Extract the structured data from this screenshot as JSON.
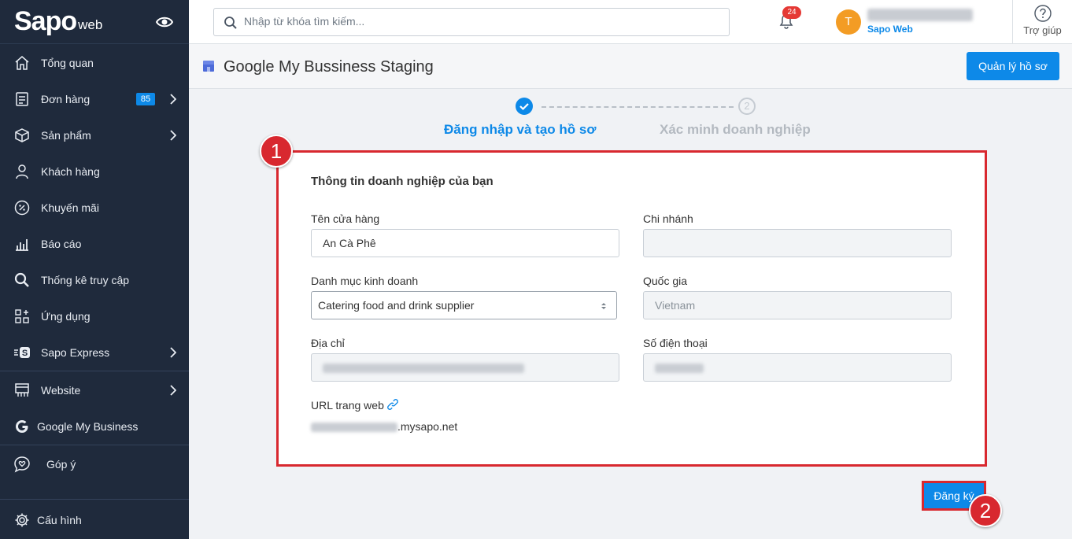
{
  "sidebar": {
    "logo_main": "Sapo",
    "logo_sub": "web",
    "items": [
      {
        "label": "Tổng quan"
      },
      {
        "label": "Đơn hàng",
        "badge": "85"
      },
      {
        "label": "Sản phẩm"
      },
      {
        "label": "Khách hàng"
      },
      {
        "label": "Khuyến mãi"
      },
      {
        "label": "Báo cáo"
      },
      {
        "label": "Thống kê truy cập"
      },
      {
        "label": "Ứng dụng"
      },
      {
        "label": "Sapo Express"
      },
      {
        "label": "Website"
      },
      {
        "label": "Google My Business"
      },
      {
        "label": "Góp ý"
      },
      {
        "label": "Cấu hình"
      }
    ]
  },
  "topbar": {
    "search_placeholder": "Nhập từ khóa tìm kiếm...",
    "notification_count": "24",
    "avatar_initial": "T",
    "store_name": "Sapo Web",
    "help_label": "Trợ giúp"
  },
  "header": {
    "title": "Google My Bussiness Staging",
    "manage_button": "Quản lý hồ sơ"
  },
  "stepper": {
    "step1_label": "Đăng nhập và tạo hồ sơ",
    "step2_number": "2",
    "step2_label": "Xác minh doanh nghiệp"
  },
  "form": {
    "title": "Thông tin doanh nghiệp của bạn",
    "store_name_label": "Tên cửa hàng",
    "store_name_value": "An Cà Phê",
    "branch_label": "Chi nhánh",
    "category_label": "Danh mục kinh doanh",
    "category_value": "Catering food and drink supplier",
    "country_label": "Quốc gia",
    "country_value": "Vietnam",
    "address_label": "Địa chỉ",
    "phone_label": "Số điện thoại",
    "url_label": "URL trang web",
    "url_suffix": ".mysapo.net"
  },
  "actions": {
    "register_button": "Đăng ký"
  },
  "markers": {
    "m1": "1",
    "m2": "2"
  },
  "colors": {
    "sidebar_bg": "#1f2a3c",
    "accent": "#0d89e8",
    "highlight_red": "#d8282f",
    "avatar": "#f39c24"
  }
}
